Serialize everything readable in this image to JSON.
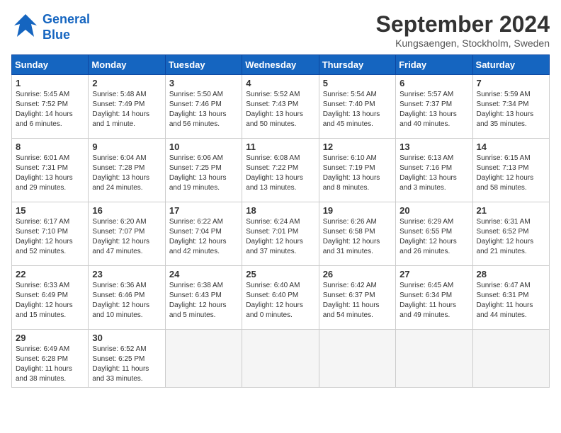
{
  "header": {
    "logo_line1": "General",
    "logo_line2": "Blue",
    "month_title": "September 2024",
    "location": "Kungsaengen, Stockholm, Sweden"
  },
  "weekdays": [
    "Sunday",
    "Monday",
    "Tuesday",
    "Wednesday",
    "Thursday",
    "Friday",
    "Saturday"
  ],
  "weeks": [
    [
      {
        "day": "1",
        "info": "Sunrise: 5:45 AM\nSunset: 7:52 PM\nDaylight: 14 hours\nand 6 minutes."
      },
      {
        "day": "2",
        "info": "Sunrise: 5:48 AM\nSunset: 7:49 PM\nDaylight: 14 hours\nand 1 minute."
      },
      {
        "day": "3",
        "info": "Sunrise: 5:50 AM\nSunset: 7:46 PM\nDaylight: 13 hours\nand 56 minutes."
      },
      {
        "day": "4",
        "info": "Sunrise: 5:52 AM\nSunset: 7:43 PM\nDaylight: 13 hours\nand 50 minutes."
      },
      {
        "day": "5",
        "info": "Sunrise: 5:54 AM\nSunset: 7:40 PM\nDaylight: 13 hours\nand 45 minutes."
      },
      {
        "day": "6",
        "info": "Sunrise: 5:57 AM\nSunset: 7:37 PM\nDaylight: 13 hours\nand 40 minutes."
      },
      {
        "day": "7",
        "info": "Sunrise: 5:59 AM\nSunset: 7:34 PM\nDaylight: 13 hours\nand 35 minutes."
      }
    ],
    [
      {
        "day": "8",
        "info": "Sunrise: 6:01 AM\nSunset: 7:31 PM\nDaylight: 13 hours\nand 29 minutes."
      },
      {
        "day": "9",
        "info": "Sunrise: 6:04 AM\nSunset: 7:28 PM\nDaylight: 13 hours\nand 24 minutes."
      },
      {
        "day": "10",
        "info": "Sunrise: 6:06 AM\nSunset: 7:25 PM\nDaylight: 13 hours\nand 19 minutes."
      },
      {
        "day": "11",
        "info": "Sunrise: 6:08 AM\nSunset: 7:22 PM\nDaylight: 13 hours\nand 13 minutes."
      },
      {
        "day": "12",
        "info": "Sunrise: 6:10 AM\nSunset: 7:19 PM\nDaylight: 13 hours\nand 8 minutes."
      },
      {
        "day": "13",
        "info": "Sunrise: 6:13 AM\nSunset: 7:16 PM\nDaylight: 13 hours\nand 3 minutes."
      },
      {
        "day": "14",
        "info": "Sunrise: 6:15 AM\nSunset: 7:13 PM\nDaylight: 12 hours\nand 58 minutes."
      }
    ],
    [
      {
        "day": "15",
        "info": "Sunrise: 6:17 AM\nSunset: 7:10 PM\nDaylight: 12 hours\nand 52 minutes."
      },
      {
        "day": "16",
        "info": "Sunrise: 6:20 AM\nSunset: 7:07 PM\nDaylight: 12 hours\nand 47 minutes."
      },
      {
        "day": "17",
        "info": "Sunrise: 6:22 AM\nSunset: 7:04 PM\nDaylight: 12 hours\nand 42 minutes."
      },
      {
        "day": "18",
        "info": "Sunrise: 6:24 AM\nSunset: 7:01 PM\nDaylight: 12 hours\nand 37 minutes."
      },
      {
        "day": "19",
        "info": "Sunrise: 6:26 AM\nSunset: 6:58 PM\nDaylight: 12 hours\nand 31 minutes."
      },
      {
        "day": "20",
        "info": "Sunrise: 6:29 AM\nSunset: 6:55 PM\nDaylight: 12 hours\nand 26 minutes."
      },
      {
        "day": "21",
        "info": "Sunrise: 6:31 AM\nSunset: 6:52 PM\nDaylight: 12 hours\nand 21 minutes."
      }
    ],
    [
      {
        "day": "22",
        "info": "Sunrise: 6:33 AM\nSunset: 6:49 PM\nDaylight: 12 hours\nand 15 minutes."
      },
      {
        "day": "23",
        "info": "Sunrise: 6:36 AM\nSunset: 6:46 PM\nDaylight: 12 hours\nand 10 minutes."
      },
      {
        "day": "24",
        "info": "Sunrise: 6:38 AM\nSunset: 6:43 PM\nDaylight: 12 hours\nand 5 minutes."
      },
      {
        "day": "25",
        "info": "Sunrise: 6:40 AM\nSunset: 6:40 PM\nDaylight: 12 hours\nand 0 minutes."
      },
      {
        "day": "26",
        "info": "Sunrise: 6:42 AM\nSunset: 6:37 PM\nDaylight: 11 hours\nand 54 minutes."
      },
      {
        "day": "27",
        "info": "Sunrise: 6:45 AM\nSunset: 6:34 PM\nDaylight: 11 hours\nand 49 minutes."
      },
      {
        "day": "28",
        "info": "Sunrise: 6:47 AM\nSunset: 6:31 PM\nDaylight: 11 hours\nand 44 minutes."
      }
    ],
    [
      {
        "day": "29",
        "info": "Sunrise: 6:49 AM\nSunset: 6:28 PM\nDaylight: 11 hours\nand 38 minutes."
      },
      {
        "day": "30",
        "info": "Sunrise: 6:52 AM\nSunset: 6:25 PM\nDaylight: 11 hours\nand 33 minutes."
      },
      {
        "day": "",
        "info": ""
      },
      {
        "day": "",
        "info": ""
      },
      {
        "day": "",
        "info": ""
      },
      {
        "day": "",
        "info": ""
      },
      {
        "day": "",
        "info": ""
      }
    ]
  ]
}
